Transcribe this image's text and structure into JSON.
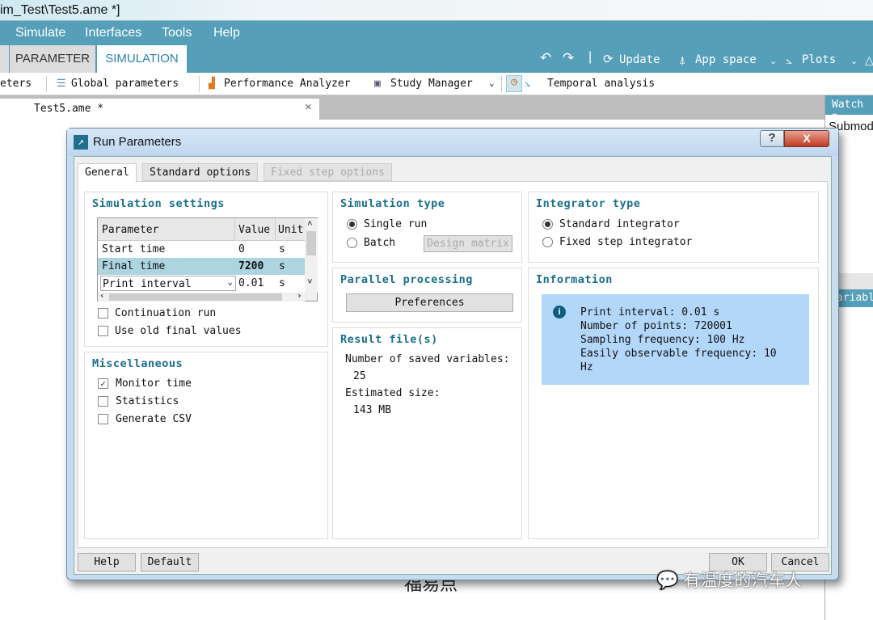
{
  "window": {
    "title": "im_Test\\Test5.ame *]"
  },
  "menu": [
    "Simulate",
    "Interfaces",
    "Tools",
    "Help"
  ],
  "ribbon_tabs": [
    "PARAMETER",
    "SIMULATION"
  ],
  "ribbon_tools": {
    "update": "Update",
    "app_space": "App space",
    "plots": "Plots"
  },
  "toolbar": {
    "parameters": "eters",
    "global_parameters": "Global parameters",
    "performance_analyzer": "Performance Analyzer",
    "study_manager": "Study Manager",
    "temporal_analysis": "Temporal analysis"
  },
  "document_tab": {
    "label": "Test5.ame *",
    "close": "×"
  },
  "side_panel": {
    "watch": "Watch p",
    "submodel": "Submod",
    "variables": "ariabl"
  },
  "dialog": {
    "title": "Run Parameters",
    "help_btn": "?",
    "close_btn": "X",
    "tabs": [
      "General",
      "Standard options",
      "Fixed step options"
    ],
    "simulation_settings": {
      "title": "Simulation settings",
      "columns": [
        "Parameter",
        "Value",
        "Unit"
      ],
      "rows": [
        {
          "parameter": "Start time",
          "value": "0",
          "unit": "s"
        },
        {
          "parameter": "Final time",
          "value": "7200",
          "unit": "s"
        },
        {
          "parameter": "Print interval",
          "value": "0.01",
          "unit": "s"
        }
      ],
      "continuation_run": {
        "label": "Continuation run",
        "checked": false
      },
      "use_old_final": {
        "label": "Use old final values",
        "checked": false
      }
    },
    "miscellaneous": {
      "title": "Miscellaneous",
      "items": [
        {
          "label": "Monitor time",
          "checked": true
        },
        {
          "label": "Statistics",
          "checked": false
        },
        {
          "label": "Generate CSV",
          "checked": false
        }
      ]
    },
    "simulation_type": {
      "title": "Simulation type",
      "single": "Single run",
      "batch": "Batch",
      "design_matrix": "Design matrix",
      "selected": "Single run"
    },
    "parallel": {
      "title": "Parallel processing",
      "preferences": "Preferences"
    },
    "result_files": {
      "title": "Result file(s)",
      "saved_label": "Number of saved variables:",
      "saved_value": "25",
      "size_label": "Estimated size:",
      "size_value": "143 MB"
    },
    "integrator": {
      "title": "Integrator type",
      "standard": "Standard integrator",
      "fixed": "Fixed step integrator",
      "selected": "Standard integrator"
    },
    "information": {
      "title": "Information",
      "lines": [
        "Print interval: 0.01 s",
        "Number of points: 720001",
        "Sampling frequency: 100 Hz",
        "Easily observable frequency: 10",
        "Hz"
      ]
    },
    "buttons": {
      "help": "Help",
      "default": "Default",
      "ok": "OK",
      "cancel": "Cancel"
    }
  },
  "watermark": "有温度的汽车人",
  "background_text": "福易点",
  "colors": {
    "accent": "#559fb9",
    "heading": "#1a6f8c",
    "info_bg": "#b3d7f9",
    "selected_row": "#acd5df"
  }
}
